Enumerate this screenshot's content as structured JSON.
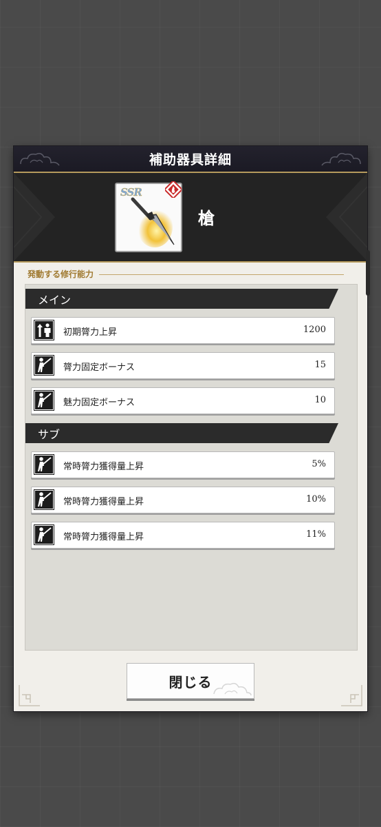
{
  "dialog": {
    "title": "補助器具詳細",
    "item": {
      "rarity": "SSR",
      "name": "槍"
    },
    "section_label": "発動する修行能力",
    "main": {
      "header": "メイン",
      "rows": [
        {
          "icon": "arrow-up-person-icon",
          "label": "初期膂力上昇",
          "value": "1200"
        },
        {
          "icon": "swordsman-icon",
          "label": "膂力固定ボーナス",
          "value": "15"
        },
        {
          "icon": "swordsman-icon",
          "label": "魅力固定ボーナス",
          "value": "10"
        }
      ]
    },
    "sub": {
      "header": "サブ",
      "rows": [
        {
          "icon": "swordsman-icon",
          "label": "常時膂力獲得量上昇",
          "value": "5%"
        },
        {
          "icon": "swordsman-icon",
          "label": "常時膂力獲得量上昇",
          "value": "10%"
        },
        {
          "icon": "swordsman-icon",
          "label": "常時膂力獲得量上昇",
          "value": "11%"
        }
      ]
    },
    "close_label": "閉じる"
  },
  "colors": {
    "accent_gold": "#b59a5c",
    "title_bg": "#1b1a24",
    "header_bg": "#2b2b2b"
  }
}
